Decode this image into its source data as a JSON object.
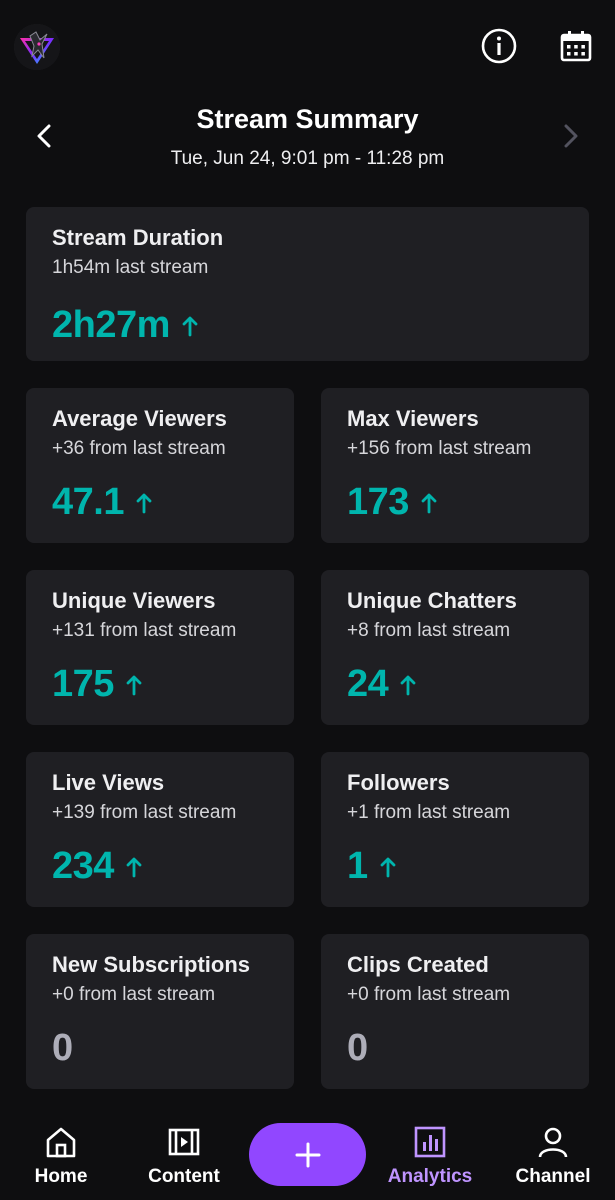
{
  "app": {
    "accent_color": "#9147ff",
    "positive_color": "#00b5ad",
    "background_color": "#0e0e10",
    "card_color": "#1f1f23"
  },
  "topbar": {
    "avatar_icon": "profile-avatar",
    "info_icon": "info-circle-icon",
    "calendar_icon": "calendar-icon"
  },
  "header": {
    "title": "Stream Summary",
    "date_range": "Tue, Jun 24, 9:01 pm - 11:28 pm",
    "prev_icon": "chevron-left-icon",
    "next_icon": "chevron-right-icon"
  },
  "stats": {
    "duration": {
      "label": "Stream Duration",
      "sub": "1h54m last stream",
      "value": "2h27m",
      "trend": "up"
    },
    "avg_viewers": {
      "label": "Average Viewers",
      "sub": "+36 from last stream",
      "value": "47.1",
      "trend": "up"
    },
    "max_viewers": {
      "label": "Max Viewers",
      "sub": "+156 from last stream",
      "value": "173",
      "trend": "up"
    },
    "unique_viewers": {
      "label": "Unique Viewers",
      "sub": "+131 from last stream",
      "value": "175",
      "trend": "up"
    },
    "unique_chatters": {
      "label": "Unique Chatters",
      "sub": "+8 from last stream",
      "value": "24",
      "trend": "up"
    },
    "live_views": {
      "label": "Live Views",
      "sub": "+139 from last stream",
      "value": "234",
      "trend": "up"
    },
    "followers": {
      "label": "Followers",
      "sub": "+1 from last stream",
      "value": "1",
      "trend": "up"
    },
    "new_subs": {
      "label": "New Subscriptions",
      "sub": "+0 from last stream",
      "value": "0",
      "trend": "none"
    },
    "clips": {
      "label": "Clips Created",
      "sub": "+0 from last stream",
      "value": "0",
      "trend": "none"
    }
  },
  "bottom_nav": {
    "home": {
      "label": "Home",
      "icon": "home-icon"
    },
    "content": {
      "label": "Content",
      "icon": "video-content-icon"
    },
    "create": {
      "icon": "plus-icon"
    },
    "analytics": {
      "label": "Analytics",
      "icon": "bar-chart-icon",
      "active": true
    },
    "channel": {
      "label": "Channel",
      "icon": "user-icon"
    }
  }
}
